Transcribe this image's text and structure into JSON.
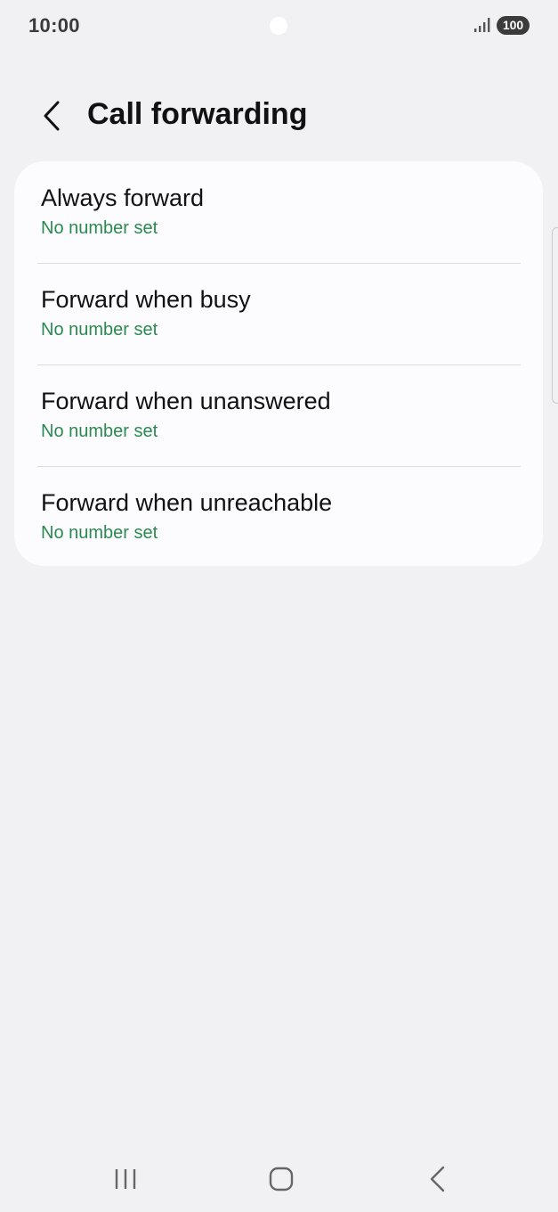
{
  "status_bar": {
    "time": "10:00",
    "battery": "100",
    "signal_icon": "signal-bars-icon"
  },
  "header": {
    "back_icon": "chevron-left-icon",
    "title": "Call forwarding"
  },
  "forwarding_options": [
    {
      "label": "Always forward",
      "value": "No number set"
    },
    {
      "label": "Forward when busy",
      "value": "No number set"
    },
    {
      "label": "Forward when unanswered",
      "value": "No number set"
    },
    {
      "label": "Forward when unreachable",
      "value": "No number set"
    }
  ],
  "nav_bar": {
    "recents_icon": "recent-apps-icon",
    "home_icon": "home-icon",
    "back_icon": "back-icon"
  },
  "colors": {
    "background": "#f1f1f4",
    "card": "#fcfcfe",
    "accent_green": "#2a8a4f",
    "text": "#111111"
  }
}
